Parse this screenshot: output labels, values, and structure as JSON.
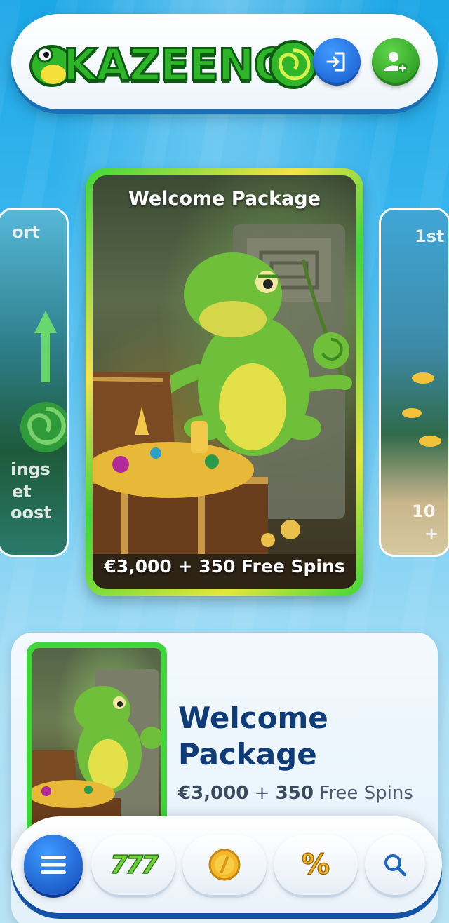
{
  "brand": {
    "name": "KAZEENO"
  },
  "header": {
    "login_icon": "login-icon",
    "register_icon": "add-user-icon"
  },
  "carousel": {
    "left_card": {
      "line1": "ort",
      "line2": "ings",
      "line3": "et",
      "line4": "oost"
    },
    "main_card": {
      "title": "Welcome Package",
      "subtitle": "€3,000 + 350 Free Spins"
    },
    "right_card": {
      "line1": "1st",
      "line2": "10",
      "line3": "+"
    }
  },
  "promo": {
    "title": "Welcome Package",
    "amount": "€3,000",
    "plus": "+",
    "spins": "350",
    "spins_label": "Free Spins"
  },
  "bottom_nav": {
    "menu_icon": "hamburger-menu-icon",
    "slots_label": "777",
    "coin_icon": "coin-icon",
    "promo_label": "%",
    "search_icon": "search-icon"
  },
  "colors": {
    "accent_green": "#3fd63a",
    "accent_blue": "#1455c9",
    "title_navy": "#0f3c78"
  }
}
